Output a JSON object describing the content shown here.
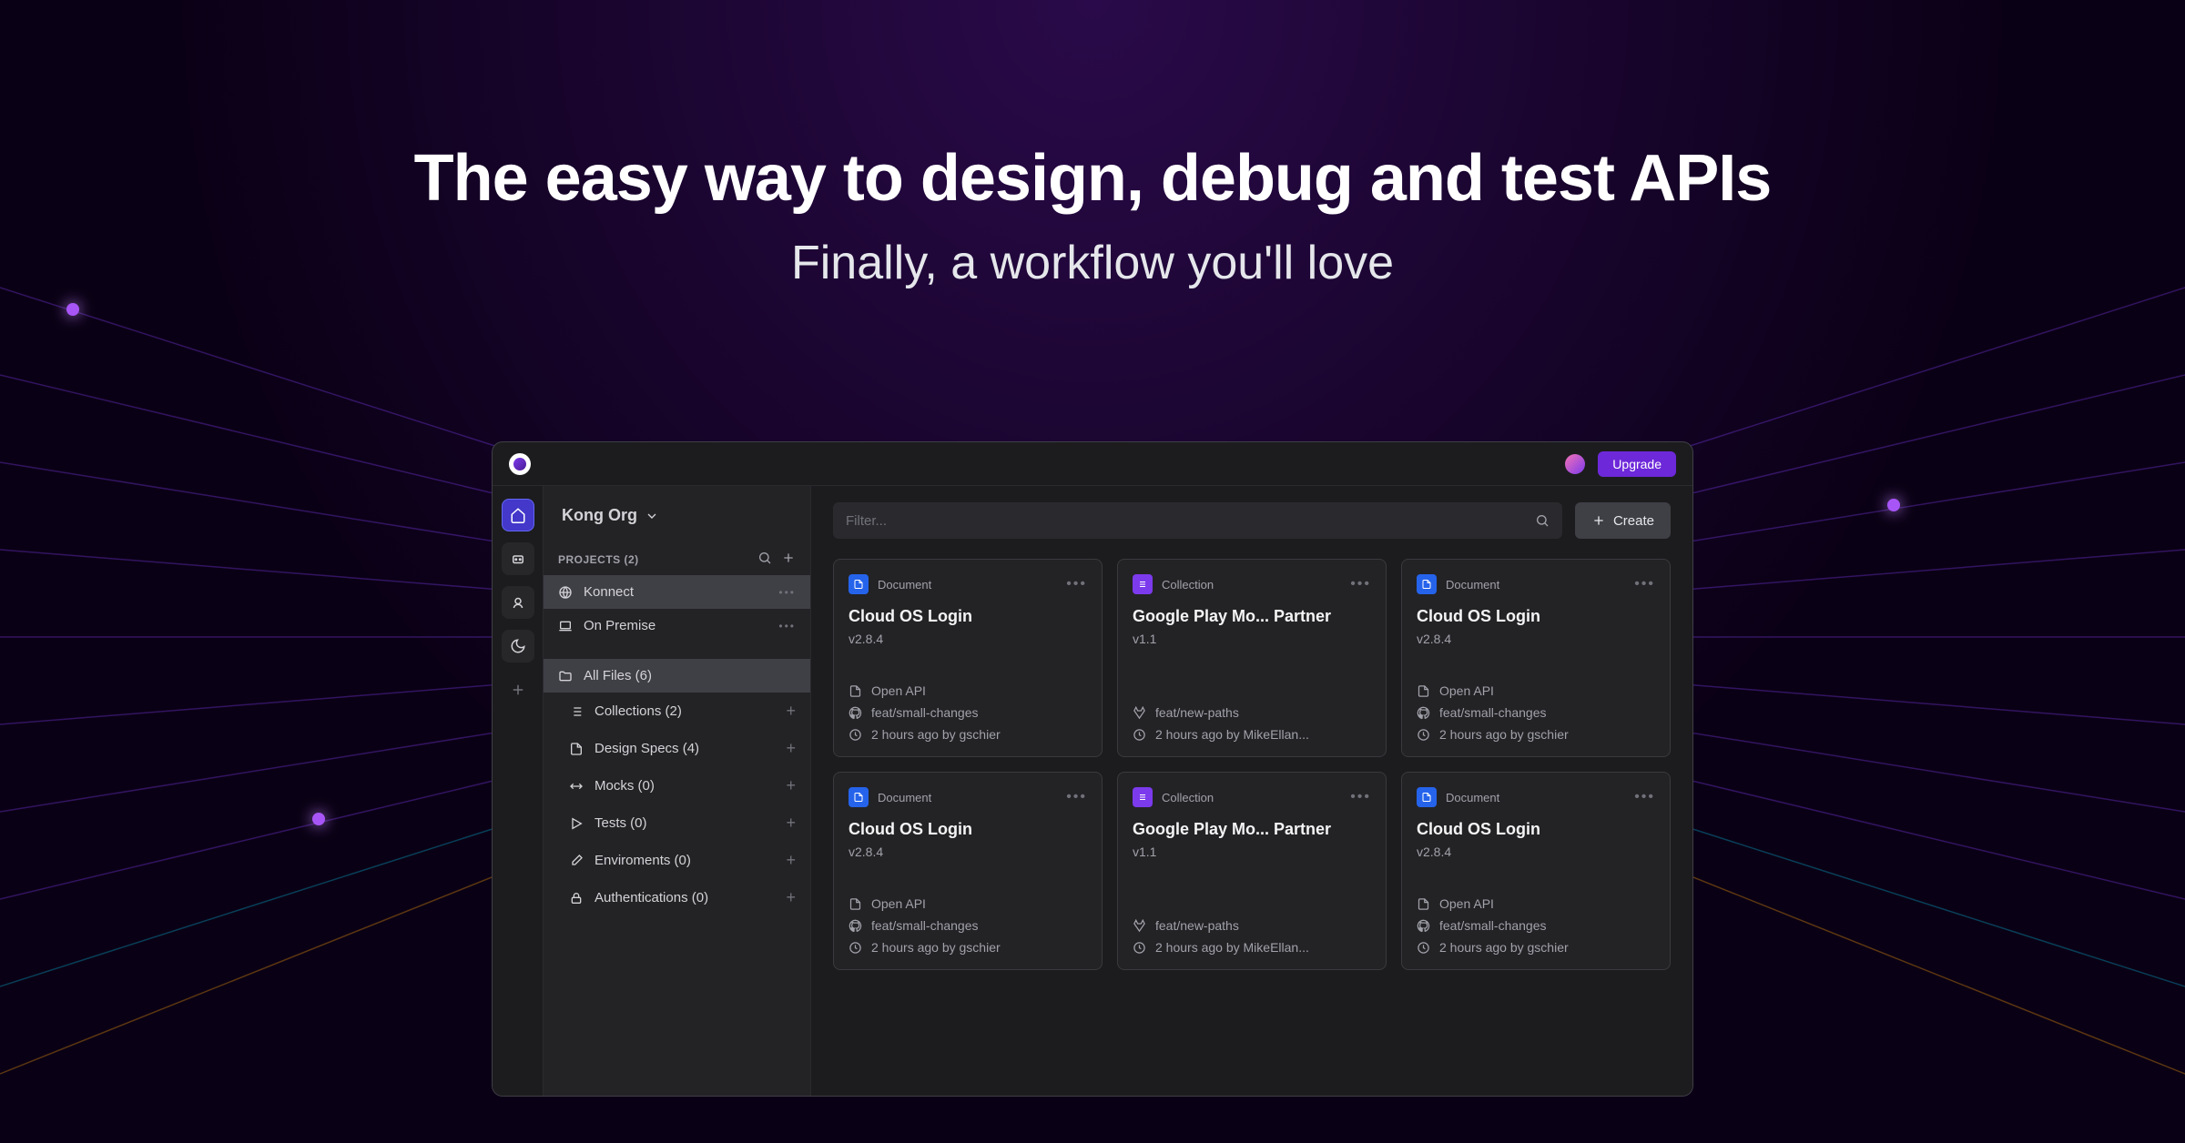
{
  "hero": {
    "title": "The easy way to design, debug and test APIs",
    "subtitle": "Finally, a workflow you'll love"
  },
  "titlebar": {
    "upgrade_label": "Upgrade"
  },
  "sidebar": {
    "org_name": "Kong Org",
    "projects_header": "PROJECTS (2)",
    "projects": [
      {
        "name": "Konnect",
        "icon": "globe",
        "selected": true
      },
      {
        "name": "On Premise",
        "icon": "laptop",
        "selected": false
      }
    ],
    "all_files_label": "All Files (6)",
    "sections": [
      {
        "label": "Collections (2)",
        "icon": "list"
      },
      {
        "label": "Design Specs (4)",
        "icon": "file"
      },
      {
        "label": "Mocks (0)",
        "icon": "swap"
      },
      {
        "label": "Tests (0)",
        "icon": "play"
      },
      {
        "label": "Enviroments (0)",
        "icon": "edit"
      },
      {
        "label": "Authentications (0)",
        "icon": "lock"
      }
    ]
  },
  "toolbar": {
    "filter_placeholder": "Filter...",
    "create_label": "Create"
  },
  "type_labels": {
    "document": "Document",
    "collection": "Collection"
  },
  "cards": [
    {
      "type": "document",
      "title": "Cloud OS Login",
      "version": "v2.8.4",
      "api": "Open API",
      "branch": "feat/small-changes",
      "branch_icon": "github",
      "time": "2 hours ago by gschier"
    },
    {
      "type": "collection",
      "title": "Google Play Mo... Partner",
      "version": "v1.1",
      "api": "",
      "branch": "feat/new-paths",
      "branch_icon": "gitlab",
      "time": "2 hours ago by MikeEllan..."
    },
    {
      "type": "document",
      "title": "Cloud OS Login",
      "version": "v2.8.4",
      "api": "Open API",
      "branch": "feat/small-changes",
      "branch_icon": "github",
      "time": "2 hours ago by gschier"
    },
    {
      "type": "document",
      "title": "Cloud OS Login",
      "version": "v2.8.4",
      "api": "Open API",
      "branch": "feat/small-changes",
      "branch_icon": "github",
      "time": "2 hours ago by gschier"
    },
    {
      "type": "collection",
      "title": "Google Play Mo... Partner",
      "version": "v1.1",
      "api": "",
      "branch": "feat/new-paths",
      "branch_icon": "gitlab",
      "time": "2 hours ago by MikeEllan..."
    },
    {
      "type": "document",
      "title": "Cloud OS Login",
      "version": "v2.8.4",
      "api": "Open API",
      "branch": "feat/small-changes",
      "branch_icon": "github",
      "time": "2 hours ago by gschier"
    }
  ]
}
